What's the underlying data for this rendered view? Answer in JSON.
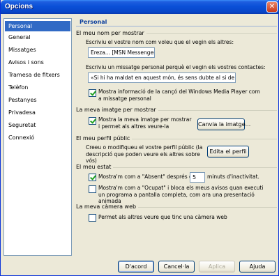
{
  "window": {
    "title": "Opcions",
    "close": "✕"
  },
  "sidebar": {
    "items": [
      {
        "label": "Personal"
      },
      {
        "label": "General"
      },
      {
        "label": "Missatges"
      },
      {
        "label": "Avisos i sons"
      },
      {
        "label": "Tramesa de fitxers"
      },
      {
        "label": "Telèfon"
      },
      {
        "label": "Pestanyes"
      },
      {
        "label": "Privadesa"
      },
      {
        "label": "Seguretat"
      },
      {
        "label": "Connexió"
      }
    ],
    "selected": "Personal"
  },
  "panel": {
    "title": "Personal",
    "name_section": {
      "heading": "El meu nom per mostrar",
      "name_prompt": "Escriviu el vostre nom com voleu que el vegin els altres:",
      "name_value": "Ereza... [MSN Messenger",
      "message_prompt": "Escriviu un missatge personal perquè el vegin els vostres contactes:",
      "message_value": "«Si hi ha maldat en aquest món, és sens dubte al si de",
      "show_song_label": "Mostra informació de la cançó del Windows Media Player com a missatge personal",
      "show_song_checked": true
    },
    "image_section": {
      "heading": "La meva imatge per mostrar",
      "show_image_label": "Mostra la meva imatge per mostrar i permet als altres veure-la",
      "show_image_checked": true,
      "change_image_button": "Canvia la imatge..."
    },
    "profile_section": {
      "heading": "El meu perfil públic",
      "description": "Creeu o modifiqueu el vostre perfil públic (la descripció que poden veure els altres sobre vós)",
      "edit_profile_button": "Edita el perfil"
    },
    "status_section": {
      "heading": "El meu estat",
      "away_prefix": "Mostra'm com a \"Absent\" després de",
      "away_minutes": "5",
      "away_suffix": "minuts d'inactivitat.",
      "away_checked": true,
      "busy_label": "Mostra'm com a \"Ocupat\" i bloca els meus avisos quan executi un programa a pantalla completa, com ara una presentació animada",
      "busy_checked": false
    },
    "webcam_section": {
      "heading": "La meva càmera web",
      "webcam_label": "Permet als altres veure que tinc una càmera web",
      "webcam_checked": false
    }
  },
  "footer": {
    "ok": "D'acord",
    "cancel": "Cancel·la",
    "apply": "Aplica",
    "help": "Ajuda"
  }
}
